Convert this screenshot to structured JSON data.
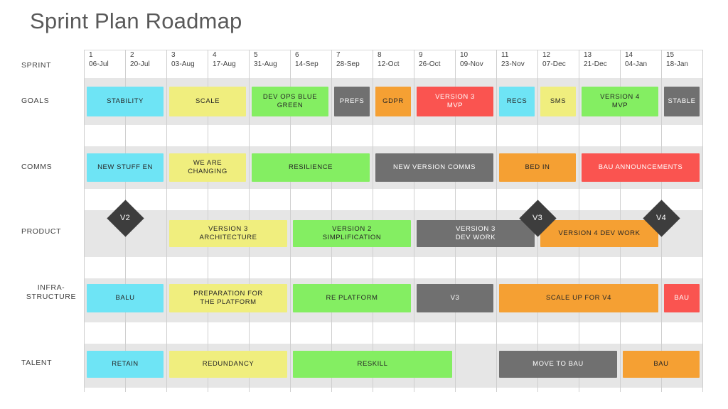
{
  "title": "Sprint Plan Roadmap",
  "axis": {
    "header_label": "SPRINT",
    "sprints": [
      {
        "num": "1",
        "date": "06-Jul"
      },
      {
        "num": "2",
        "date": "20-Jul"
      },
      {
        "num": "3",
        "date": "03-Aug"
      },
      {
        "num": "4",
        "date": "17-Aug"
      },
      {
        "num": "5",
        "date": "31-Aug"
      },
      {
        "num": "6",
        "date": "14-Sep"
      },
      {
        "num": "7",
        "date": "28-Sep"
      },
      {
        "num": "8",
        "date": "12-Oct"
      },
      {
        "num": "9",
        "date": "26-Oct"
      },
      {
        "num": "10",
        "date": "09-Nov"
      },
      {
        "num": "11",
        "date": "23-Nov"
      },
      {
        "num": "12",
        "date": "07-Dec"
      },
      {
        "num": "13",
        "date": "21-Dec"
      },
      {
        "num": "14",
        "date": "04-Jan"
      },
      {
        "num": "15",
        "date": "18-Jan"
      }
    ]
  },
  "rows": [
    {
      "key": "goals",
      "label": "GOALS"
    },
    {
      "key": "comms",
      "label": "COMMS"
    },
    {
      "key": "product",
      "label": "PRODUCT"
    },
    {
      "key": "infra",
      "label": "INFRA-\nSTRUCTURE"
    },
    {
      "key": "talent",
      "label": "TALENT"
    }
  ],
  "colors": {
    "cyan": "#6EE4F5",
    "yellow": "#F0EE7E",
    "green": "#84EE62",
    "gray": "#707070",
    "orange": "#F5A033",
    "red": "#FA5450",
    "band": "#E6E6E6",
    "diamond": "#3D3D3D",
    "title": "#595959"
  },
  "chart_data": {
    "type": "table",
    "title": "Sprint Plan Roadmap",
    "xlabel": "SPRINT",
    "categories": [
      "1 06-Jul",
      "2 20-Jul",
      "3 03-Aug",
      "4 17-Aug",
      "5 31-Aug",
      "6 14-Sep",
      "7 28-Sep",
      "8 12-Oct",
      "9 26-Oct",
      "10 09-Nov",
      "11 23-Nov",
      "12 07-Dec",
      "13 21-Dec",
      "14 04-Jan",
      "15 18-Jan"
    ],
    "series": [
      {
        "name": "GOALS",
        "values": [
          {
            "label": "STABILITY",
            "start": 1,
            "end": 3,
            "color": "cyan"
          },
          {
            "label": "SCALE",
            "start": 3,
            "end": 5,
            "color": "yellow"
          },
          {
            "label": "DEV OPS BLUE\nGREEN",
            "start": 5,
            "end": 7,
            "color": "green"
          },
          {
            "label": "PREFS",
            "start": 7,
            "end": 8,
            "color": "gray"
          },
          {
            "label": "GDPR",
            "start": 8,
            "end": 9,
            "color": "orange"
          },
          {
            "label": "VERSION  3\nMVP",
            "start": 9,
            "end": 11,
            "color": "red"
          },
          {
            "label": "RECS",
            "start": 11,
            "end": 12,
            "color": "cyan"
          },
          {
            "label": "SMS",
            "start": 12,
            "end": 13,
            "color": "yellow"
          },
          {
            "label": "VERSION  4\nMVP",
            "start": 13,
            "end": 15,
            "color": "green"
          },
          {
            "label": "STABLE",
            "start": 15,
            "end": 16,
            "color": "gray"
          }
        ]
      },
      {
        "name": "COMMS",
        "values": [
          {
            "label": "NEW STUFF EN",
            "start": 1,
            "end": 3,
            "color": "cyan"
          },
          {
            "label": "WE ARE\nCHANGING",
            "start": 3,
            "end": 5,
            "color": "yellow"
          },
          {
            "label": "RESILIENCE",
            "start": 5,
            "end": 8,
            "color": "green"
          },
          {
            "label": "NEW VERSION  COMMS",
            "start": 8,
            "end": 11,
            "color": "gray"
          },
          {
            "label": "BED IN",
            "start": 11,
            "end": 13,
            "color": "orange"
          },
          {
            "label": "BAU ANNOUNCEMENTS",
            "start": 13,
            "end": 16,
            "color": "red"
          }
        ]
      },
      {
        "name": "PRODUCT",
        "values": [
          {
            "label": "VERSION  3\nARCHITECTURE",
            "start": 3,
            "end": 6,
            "color": "yellow"
          },
          {
            "label": "VERSION  2\nSIMPLIFICATION",
            "start": 6,
            "end": 9,
            "color": "green"
          },
          {
            "label": "VERSION  3\nDEV  WORK",
            "start": 9,
            "end": 12,
            "color": "gray"
          },
          {
            "label": "VERSION  4 DEV  WORK",
            "start": 12,
            "end": 15,
            "color": "orange"
          }
        ],
        "milestones": [
          {
            "label": "V2",
            "at": 2
          },
          {
            "label": "V3",
            "at": 12
          },
          {
            "label": "V4",
            "at": 15
          }
        ]
      },
      {
        "name": "INFRA-STRUCTURE",
        "values": [
          {
            "label": "BALU",
            "start": 1,
            "end": 3,
            "color": "cyan"
          },
          {
            "label": "PREPARATION  FOR\nTHE PLATFORM",
            "start": 3,
            "end": 6,
            "color": "yellow"
          },
          {
            "label": "RE PLATFORM",
            "start": 6,
            "end": 9,
            "color": "green"
          },
          {
            "label": "V3",
            "start": 9,
            "end": 11,
            "color": "gray"
          },
          {
            "label": "SCALE UP FOR V4",
            "start": 11,
            "end": 15,
            "color": "orange"
          },
          {
            "label": "BAU",
            "start": 15,
            "end": 16,
            "color": "red"
          }
        ]
      },
      {
        "name": "TALENT",
        "values": [
          {
            "label": "RETAIN",
            "start": 1,
            "end": 3,
            "color": "cyan"
          },
          {
            "label": "REDUNDANCY",
            "start": 3,
            "end": 6,
            "color": "yellow"
          },
          {
            "label": "RESKILL",
            "start": 6,
            "end": 10,
            "color": "green"
          },
          {
            "label": "MOVE TO BAU",
            "start": 11,
            "end": 14,
            "color": "gray"
          },
          {
            "label": "BAU",
            "start": 14,
            "end": 16,
            "color": "orange"
          }
        ]
      }
    ]
  }
}
